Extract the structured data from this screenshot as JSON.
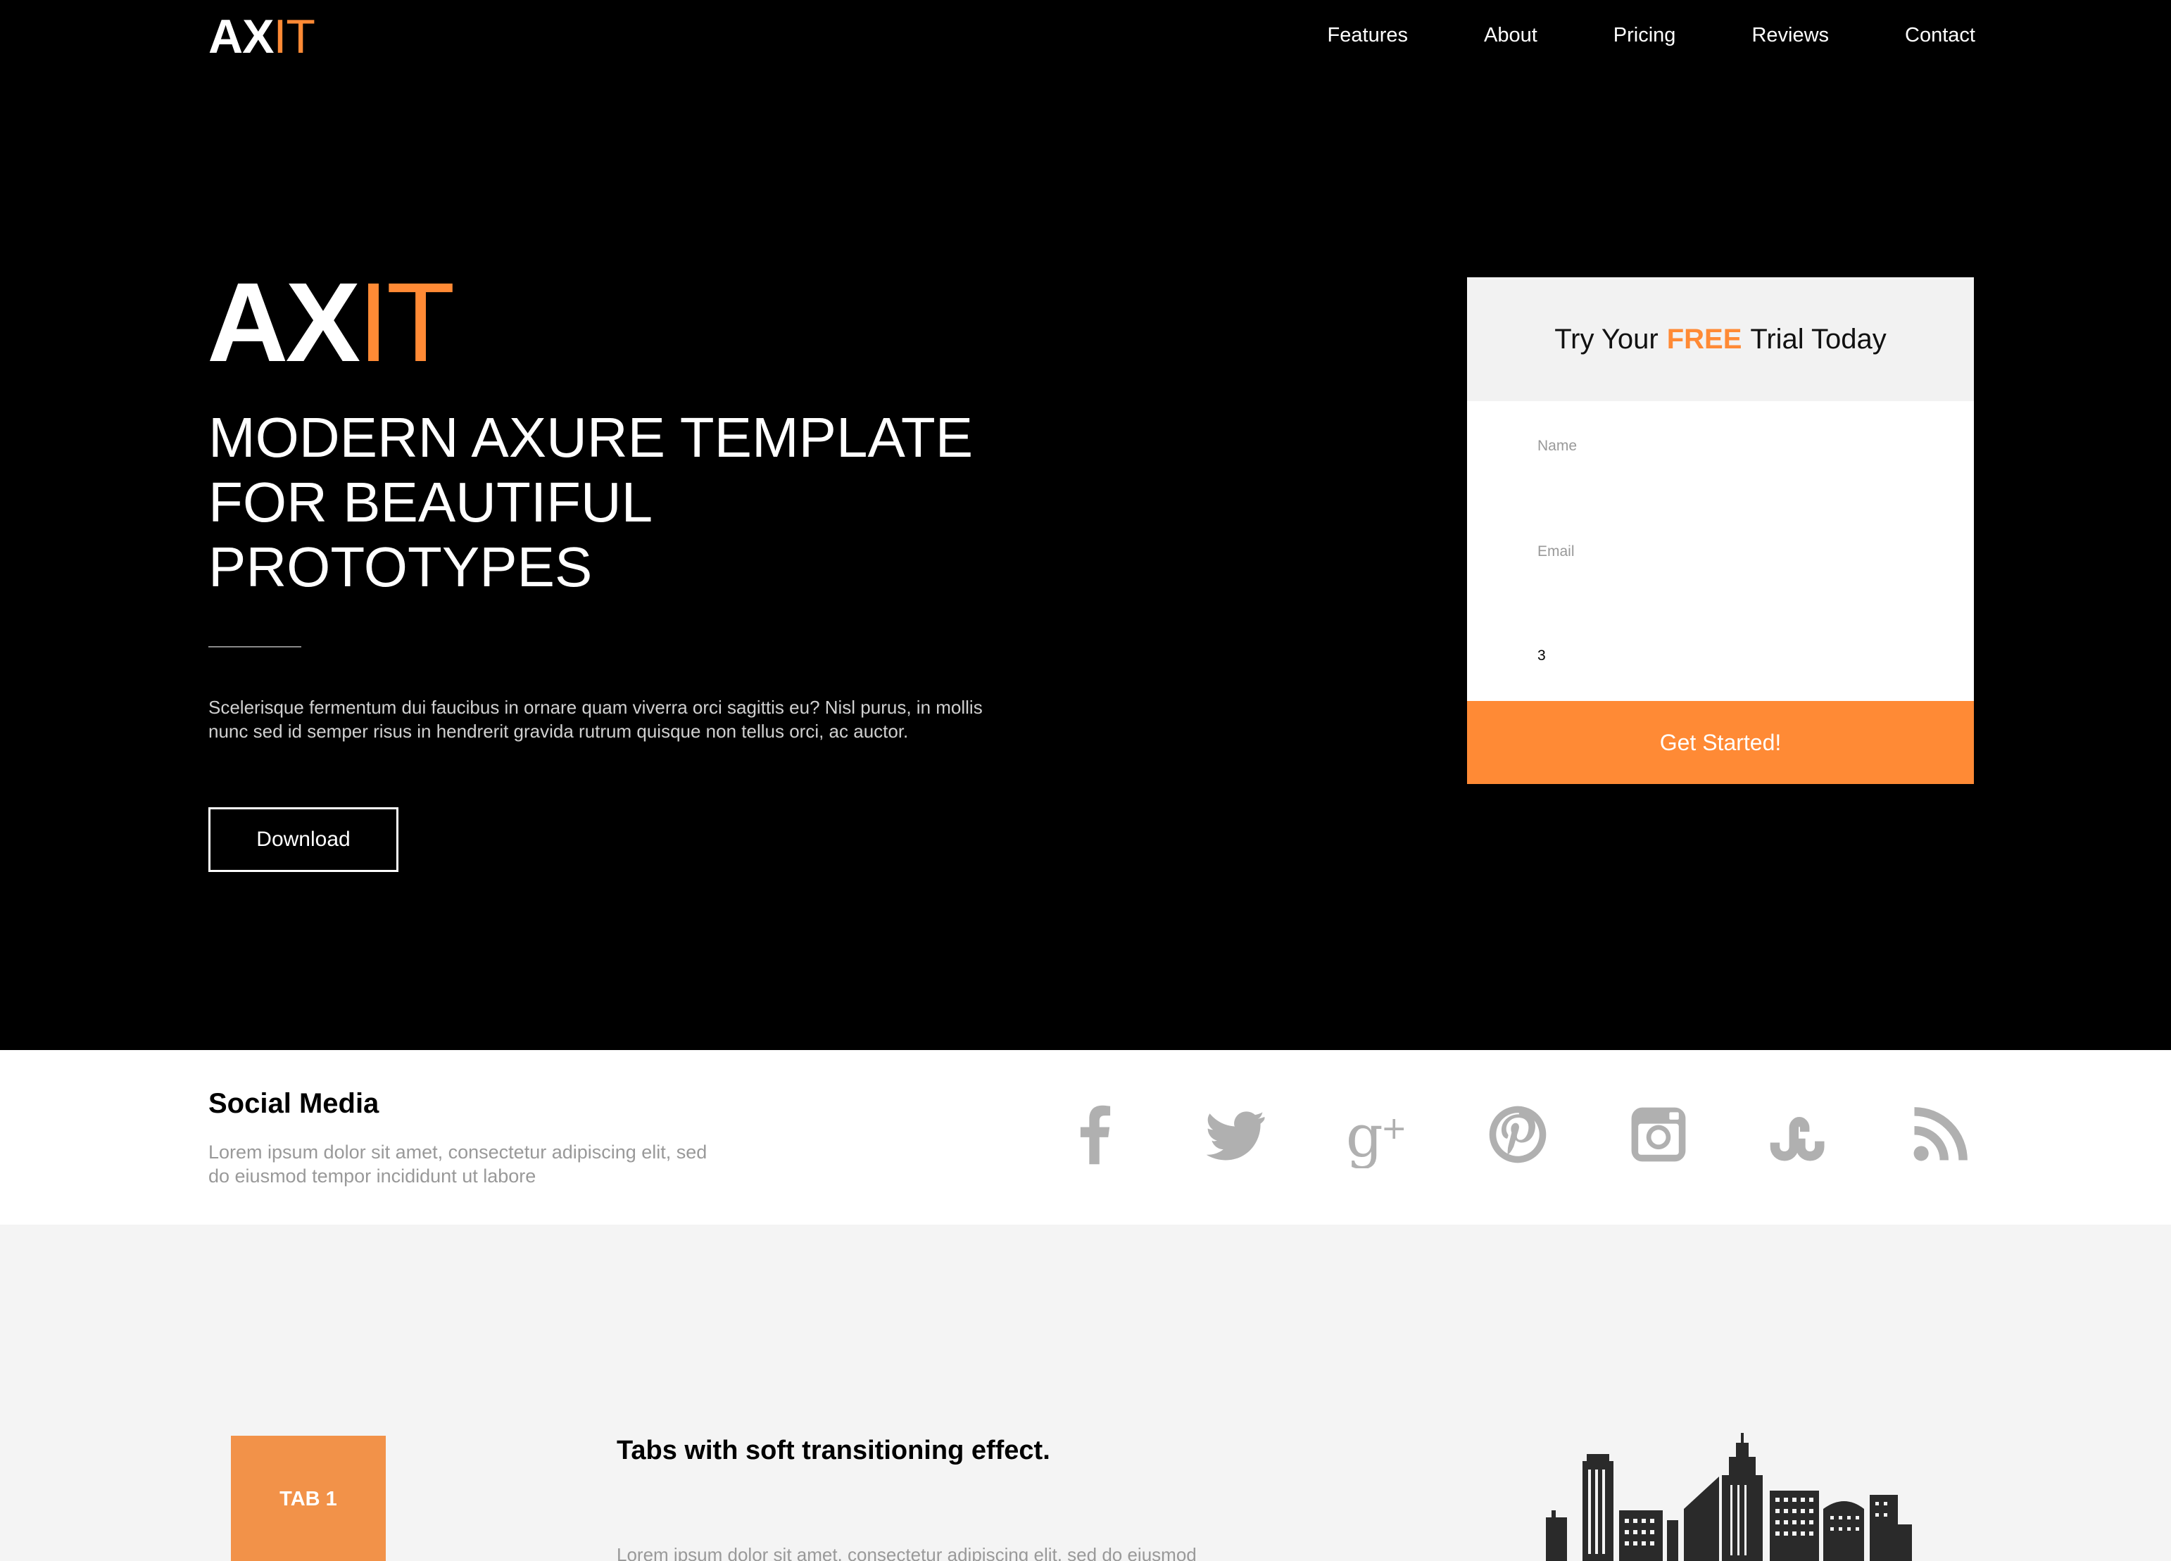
{
  "colors": {
    "accent": "#ff8a35",
    "hero_bg": "#000000",
    "tab_bg": "#f29249",
    "icon_gray": "#b0b0b0"
  },
  "brand": {
    "logo_bold": "AX",
    "logo_light": "IT"
  },
  "nav": {
    "items": [
      {
        "label": "Features"
      },
      {
        "label": "About"
      },
      {
        "label": "Pricing"
      },
      {
        "label": "Reviews"
      },
      {
        "label": "Contact"
      }
    ]
  },
  "hero": {
    "logo_bold": "AX",
    "logo_light": "IT",
    "title": "MODERN AXURE TEMPLATE FOR BEAUTIFUL PROTOTYPES",
    "text": "Scelerisque fermentum dui faucibus in ornare quam viverra orci sagittis eu? Nisl purus, in mollis nunc sed id semper risus in hendrerit gravida rutrum quisque non tellus orci, ac auctor.",
    "download_label": "Download"
  },
  "trial": {
    "title_before": "Try Your",
    "title_highlight": "FREE",
    "title_after": "Trial Today",
    "name_label": "Name",
    "email_label": "Email",
    "third_value": "3",
    "submit_label": "Get Started!"
  },
  "social": {
    "title": "Social Media",
    "text": "Lorem ipsum dolor sit amet, consectetur adipiscing elit, sed do eiusmod tempor incididunt ut labore",
    "icons": [
      "facebook-icon",
      "twitter-icon",
      "google-plus-icon",
      "pinterest-icon",
      "instagram-icon",
      "stumbleupon-icon",
      "rss-icon"
    ]
  },
  "tabs": {
    "tab1_label": "TAB 1",
    "heading": "Tabs with soft transitioning effect.",
    "text": "Lorem ipsum dolor sit amet, consectetur adipiscing elit, sed do eiusmod"
  }
}
